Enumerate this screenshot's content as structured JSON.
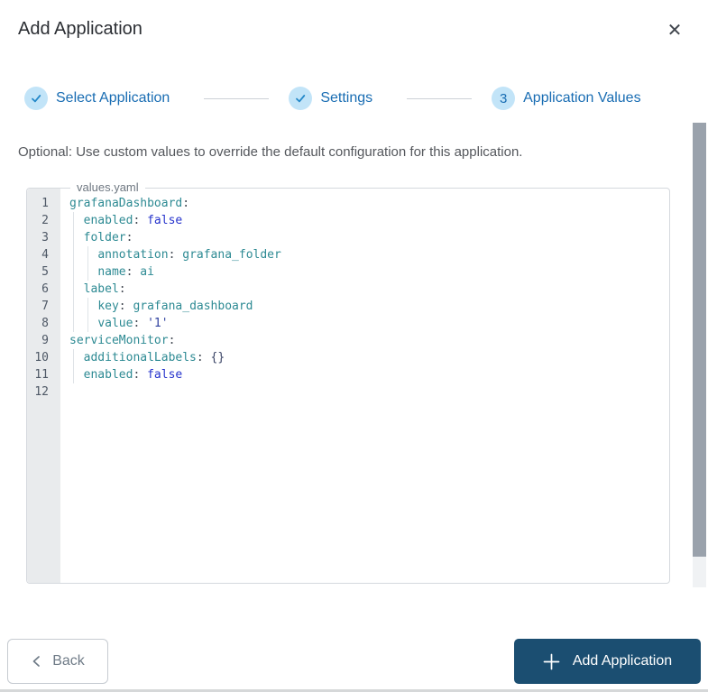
{
  "window": {
    "title": "Add Application",
    "close_icon": "✕"
  },
  "stepper": {
    "steps": [
      {
        "id": "select-application",
        "label": "Select Application",
        "state": "complete"
      },
      {
        "id": "settings",
        "label": "Settings",
        "state": "complete"
      },
      {
        "id": "application-values",
        "label": "Application Values",
        "state": "current",
        "number": "3"
      }
    ]
  },
  "content": {
    "hint": "Optional: Use custom values to override the default configuration for this application.",
    "editor": {
      "filename": "values.yaml",
      "language": "yaml",
      "lines": [
        {
          "num": "1",
          "indent": 0,
          "tokens": [
            [
              "key",
              "grafanaDashboard"
            ],
            [
              "punc",
              ":"
            ]
          ]
        },
        {
          "num": "2",
          "indent": 1,
          "tokens": [
            [
              "key",
              "enabled"
            ],
            [
              "punc",
              ":"
            ],
            [
              "bool",
              " false"
            ]
          ]
        },
        {
          "num": "3",
          "indent": 1,
          "tokens": [
            [
              "key",
              "folder"
            ],
            [
              "punc",
              ":"
            ]
          ]
        },
        {
          "num": "4",
          "indent": 2,
          "tokens": [
            [
              "key",
              "annotation"
            ],
            [
              "punc",
              ":"
            ],
            [
              "val",
              " grafana_folder"
            ]
          ]
        },
        {
          "num": "5",
          "indent": 2,
          "tokens": [
            [
              "key",
              "name"
            ],
            [
              "punc",
              ":"
            ],
            [
              "val",
              " ai"
            ]
          ]
        },
        {
          "num": "6",
          "indent": 1,
          "tokens": [
            [
              "key",
              "label"
            ],
            [
              "punc",
              ":"
            ]
          ]
        },
        {
          "num": "7",
          "indent": 2,
          "tokens": [
            [
              "key",
              "key"
            ],
            [
              "punc",
              ":"
            ],
            [
              "val",
              " grafana_dashboard"
            ]
          ]
        },
        {
          "num": "8",
          "indent": 2,
          "tokens": [
            [
              "key",
              "value"
            ],
            [
              "punc",
              ":"
            ],
            [
              "str",
              " '1'"
            ]
          ]
        },
        {
          "num": "9",
          "indent": 0,
          "tokens": [
            [
              "key",
              "serviceMonitor"
            ],
            [
              "punc",
              ":"
            ]
          ]
        },
        {
          "num": "10",
          "indent": 1,
          "tokens": [
            [
              "key",
              "additionalLabels"
            ],
            [
              "punc",
              ":"
            ],
            [
              "obj",
              " {}"
            ]
          ]
        },
        {
          "num": "11",
          "indent": 1,
          "tokens": [
            [
              "key",
              "enabled"
            ],
            [
              "punc",
              ":"
            ],
            [
              "bool",
              " false"
            ]
          ]
        },
        {
          "num": "12",
          "indent": 0,
          "tokens": []
        }
      ]
    }
  },
  "footer": {
    "back_label": "Back",
    "add_label": "Add Application"
  },
  "colors": {
    "accent_blue": "#196db3",
    "step_circle_bg": "#c2e4f8",
    "check_icon": "#2589c9",
    "primary_button_bg": "#1b4e71",
    "code_key": "#2d8a93",
    "code_value": "#2d8a93",
    "code_bool": "#2633cc",
    "code_string": "#2d3f9e",
    "code_braces": "#3a4466",
    "gutter_bg": "#e9ebed",
    "scrollbar_thumb": "#9aa2ac"
  }
}
